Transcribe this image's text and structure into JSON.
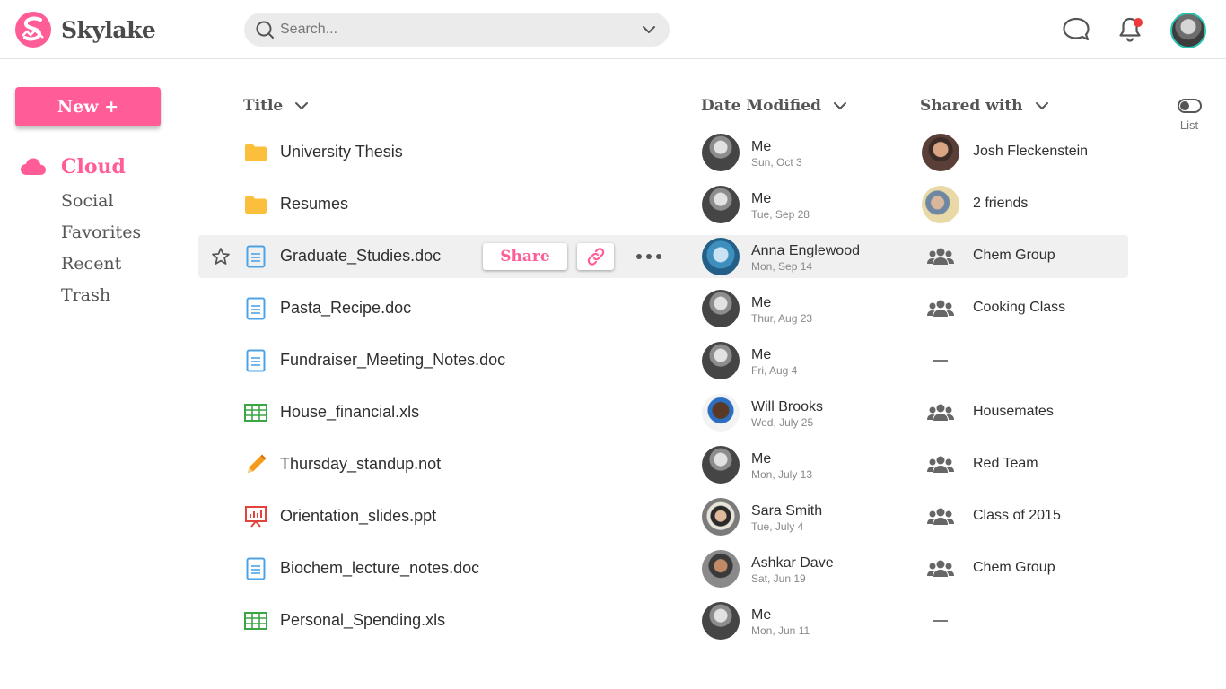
{
  "app": {
    "name": "Skylake"
  },
  "colors": {
    "accent": "#ff5c98",
    "folder": "#fbbf3b",
    "doc": "#4da3e8",
    "sheet": "#3aa544",
    "notes": "#f59b16",
    "slides": "#e0443c",
    "notification": "#f03a3a",
    "avatar_ring": "#27c4b0"
  },
  "header": {
    "search_placeholder": "Search...",
    "icons": [
      "chat-icon",
      "bell-icon",
      "avatar"
    ]
  },
  "sidebar": {
    "new_label": "New +",
    "items": [
      {
        "label": "Cloud",
        "icon": "cloud-icon",
        "active": true
      },
      {
        "label": "Social",
        "active": false
      },
      {
        "label": "Favorites",
        "active": false
      },
      {
        "label": "Recent",
        "active": false
      },
      {
        "label": "Trash",
        "active": false
      }
    ]
  },
  "table": {
    "columns": {
      "title": "Title",
      "date": "Date Modified",
      "shared": "Shared with"
    },
    "view_toggle_label": "List",
    "hover_actions": {
      "share": "Share",
      "link": "link-icon",
      "more": "more-icon"
    },
    "rows": [
      {
        "name": "University Thesis",
        "type": "folder",
        "modified_by": "Me",
        "modified": "Sun, Oct 3",
        "shared_with": "Josh Fleckenstein",
        "shared_type": "person"
      },
      {
        "name": "Resumes",
        "type": "folder",
        "modified_by": "Me",
        "modified": "Tue, Sep 28",
        "shared_with": "2 friends",
        "shared_type": "people"
      },
      {
        "name": "Graduate_Studies.doc",
        "type": "doc",
        "modified_by": "Anna Englewood",
        "modified": "Mon, Sep 14",
        "shared_with": "Chem Group",
        "shared_type": "group",
        "hovered": true
      },
      {
        "name": "Pasta_Recipe.doc",
        "type": "doc",
        "modified_by": "Me",
        "modified": "Thur, Aug 23",
        "shared_with": "Cooking Class",
        "shared_type": "group"
      },
      {
        "name": "Fundraiser_Meeting_Notes.doc",
        "type": "doc",
        "modified_by": "Me",
        "modified": "Fri, Aug 4",
        "shared_with": "",
        "shared_type": "none"
      },
      {
        "name": "House_financial.xls",
        "type": "sheet",
        "modified_by": "Will Brooks",
        "modified": "Wed, July 25",
        "shared_with": "Housemates",
        "shared_type": "group"
      },
      {
        "name": "Thursday_standup.not",
        "type": "notes",
        "modified_by": "Me",
        "modified": "Mon, July 13",
        "shared_with": "Red Team",
        "shared_type": "group"
      },
      {
        "name": "Orientation_slides.ppt",
        "type": "slides",
        "modified_by": "Sara Smith",
        "modified": "Tue, July 4",
        "shared_with": "Class of 2015",
        "shared_type": "group"
      },
      {
        "name": "Biochem_lecture_notes.doc",
        "type": "doc",
        "modified_by": "Ashkar Dave",
        "modified": "Sat, Jun 19",
        "shared_with": "Chem Group",
        "shared_type": "group"
      },
      {
        "name": "Personal_Spending.xls",
        "type": "sheet",
        "modified_by": "Me",
        "modified": "Mon, Jun 11",
        "shared_with": "",
        "shared_type": "none"
      }
    ]
  }
}
